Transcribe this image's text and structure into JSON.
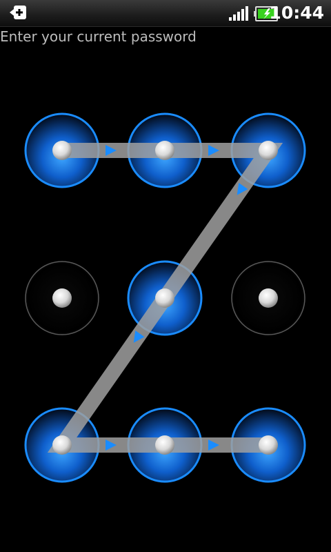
{
  "status_bar": {
    "time": "10:44",
    "left_icon": "back-arrow-icon",
    "signal_icon": "signal-bars-icon",
    "battery_icon": "battery-charging-icon",
    "battery_color": "#39d11f"
  },
  "prompt": {
    "text": "Enter your current password"
  },
  "pattern": {
    "rows": 3,
    "cols": 3,
    "active_color": "#1a8cff",
    "path_color": "#a0a0a0",
    "dots": [
      {
        "id": 1,
        "active": true
      },
      {
        "id": 2,
        "active": true
      },
      {
        "id": 3,
        "active": true
      },
      {
        "id": 4,
        "active": false
      },
      {
        "id": 5,
        "active": true
      },
      {
        "id": 6,
        "active": false
      },
      {
        "id": 7,
        "active": true
      },
      {
        "id": 8,
        "active": true
      },
      {
        "id": 9,
        "active": true
      }
    ],
    "sequence": [
      1,
      2,
      3,
      5,
      7,
      8,
      9
    ]
  }
}
